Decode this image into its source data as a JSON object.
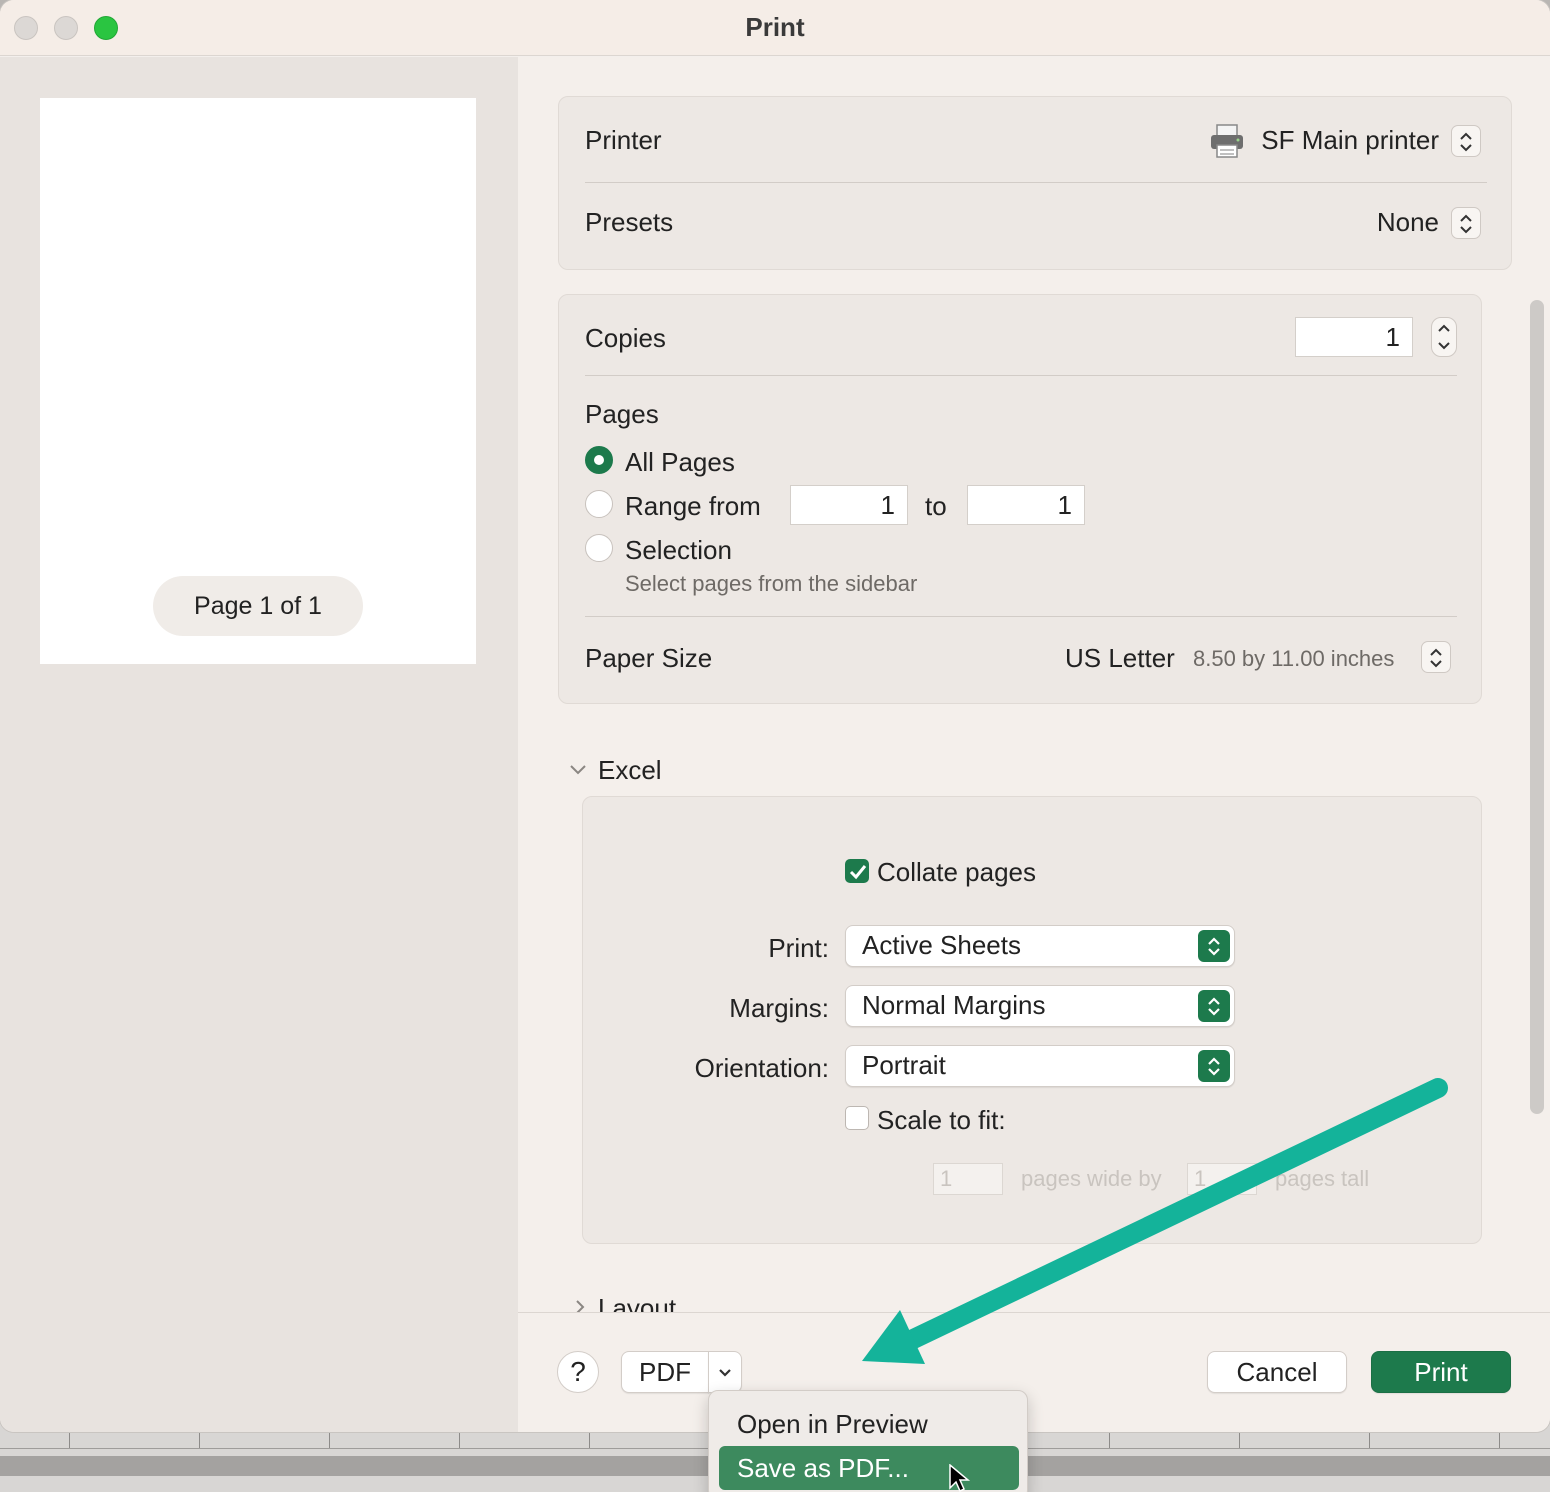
{
  "window": {
    "title": "Print"
  },
  "preview": {
    "page_label": "Page 1 of 1"
  },
  "printer": {
    "label": "Printer",
    "value": "SF Main printer"
  },
  "presets": {
    "label": "Presets",
    "value": "None"
  },
  "copies": {
    "label": "Copies",
    "value": "1"
  },
  "pages": {
    "label": "Pages",
    "all_pages": "All Pages",
    "range_from": "Range from",
    "range_start": "1",
    "to": "to",
    "range_end": "1",
    "selection": "Selection",
    "selection_hint": "Select pages from the sidebar",
    "selected": "all_pages"
  },
  "paper_size": {
    "label": "Paper Size",
    "value": "US Letter",
    "detail": "8.50 by 11.00 inches"
  },
  "excel": {
    "section_title": "Excel",
    "collate_label": "Collate pages",
    "collate_checked": true,
    "print_label": "Print:",
    "print_value": "Active Sheets",
    "margins_label": "Margins:",
    "margins_value": "Normal Margins",
    "orientation_label": "Orientation:",
    "orientation_value": "Portrait",
    "scale_label": "Scale to fit:",
    "scale_checked": false,
    "wide_value": "1",
    "wide_label": "pages wide by",
    "tall_value": "1",
    "tall_label": "pages tall"
  },
  "layout_section": {
    "title": "Layout"
  },
  "footer": {
    "help": "?",
    "pdf": "PDF",
    "cancel": "Cancel",
    "print": "Print"
  },
  "pdf_menu": {
    "items": [
      "Open in Preview",
      "Save as PDF..."
    ],
    "highlighted": 1
  },
  "colors": {
    "accent": "#1d7a4c",
    "menu_highlight": "#3d8a5e",
    "annotation_arrow": "#14b39a"
  }
}
